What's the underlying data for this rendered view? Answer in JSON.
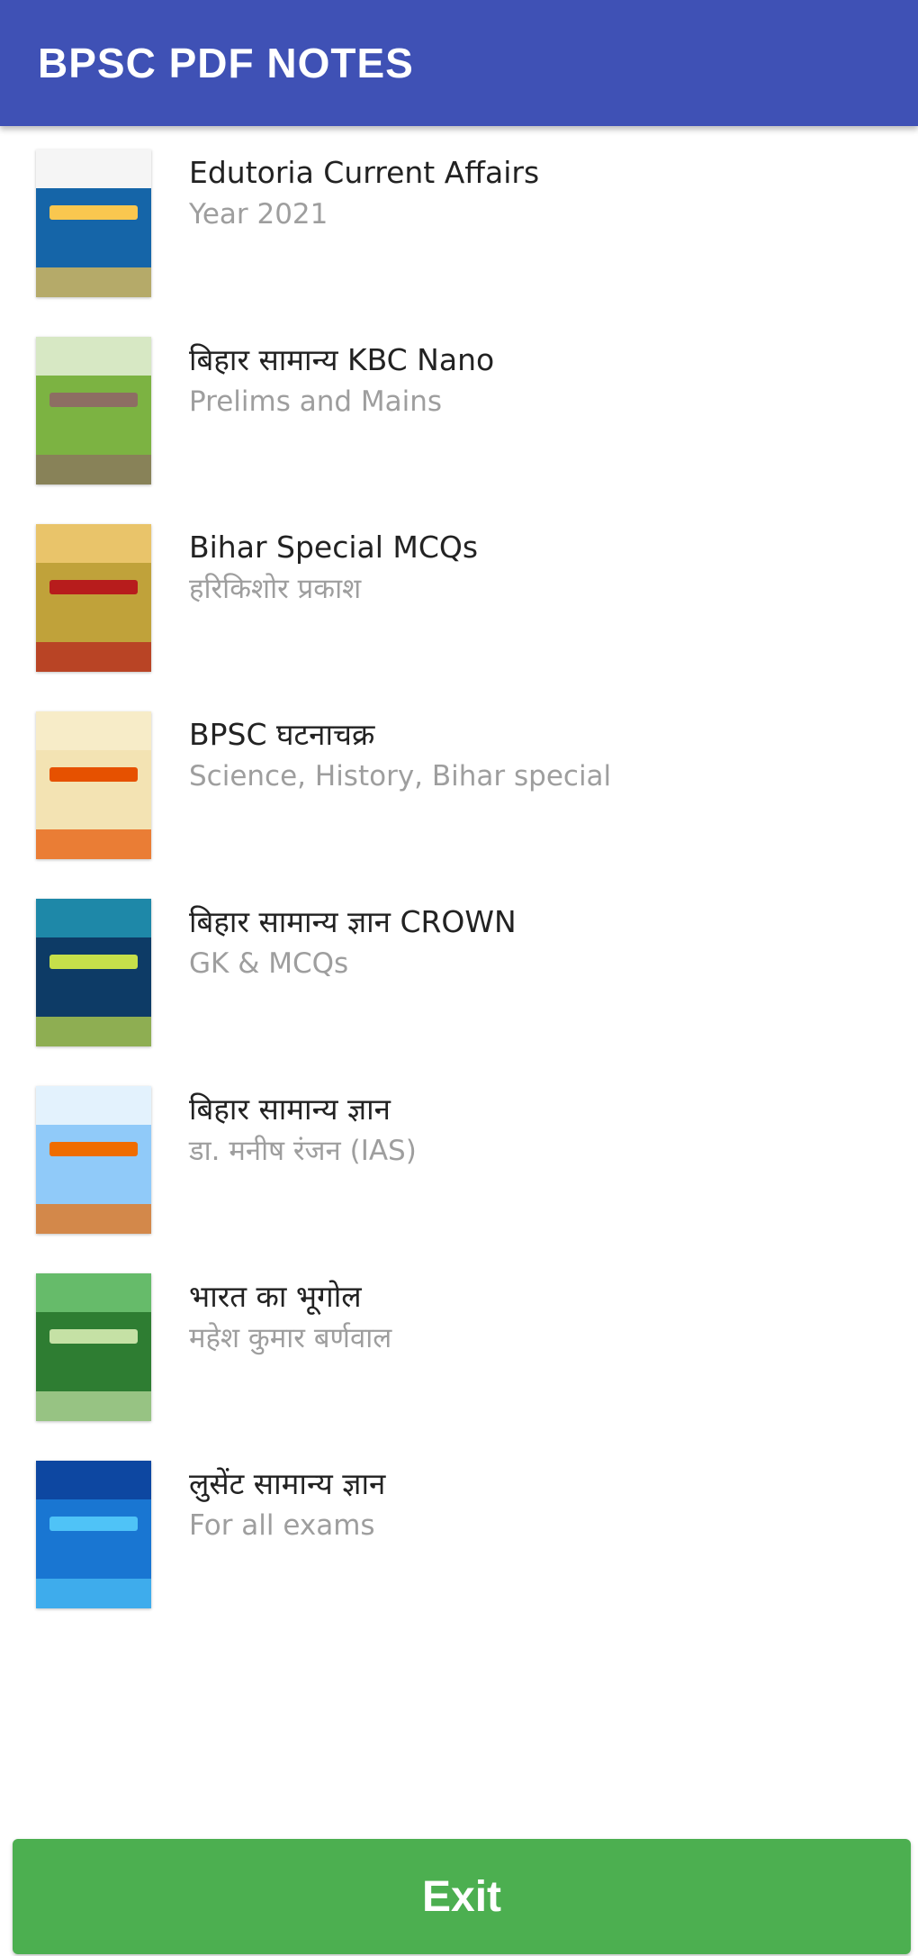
{
  "app_bar": {
    "title": "BPSC PDF NOTES"
  },
  "books": [
    {
      "title": "Edutoria Current Affairs",
      "subtitle": "Year 2021",
      "cover": {
        "bg": "#1565a8",
        "top": "#f5f5f5",
        "accent": "#f9c74f"
      }
    },
    {
      "title": "बिहार सामान्य KBC Nano",
      "subtitle": "Prelims and Mains",
      "cover": {
        "bg": "#7cb342",
        "top": "#d7e8c4",
        "accent": "#8d6e63"
      }
    },
    {
      "title": "Bihar Special MCQs",
      "subtitle": "हरिकिशोर प्रकाश",
      "cover": {
        "bg": "#c0a23a",
        "top": "#e9c46a",
        "accent": "#b71c1c"
      }
    },
    {
      "title": "BPSC घटनाचक्र",
      "subtitle": "Science, History, Bihar special",
      "cover": {
        "bg": "#f3e3b3",
        "top": "#f7ecc8",
        "accent": "#e65100"
      }
    },
    {
      "title": "बिहार सामान्य ज्ञान CROWN",
      "subtitle": " GK & MCQs",
      "cover": {
        "bg": "#0d3b66",
        "top": "#1e88a8",
        "accent": "#c6e04a"
      }
    },
    {
      "title": "बिहार सामान्य ज्ञान",
      "subtitle": "डा. मनीष रंजन (IAS)",
      "cover": {
        "bg": "#90caf9",
        "top": "#e3f2fd",
        "accent": "#ef6c00"
      }
    },
    {
      "title": "भारत का भूगोल",
      "subtitle": "महेश कुमार बर्णवाल",
      "cover": {
        "bg": "#2e7d32",
        "top": "#66bb6a",
        "accent": "#c5e1a5"
      }
    },
    {
      "title": "लुसेंट सामान्य ज्ञान",
      "subtitle": "For all exams",
      "cover": {
        "bg": "#1976d2",
        "top": "#0d47a1",
        "accent": "#4fc3f7"
      }
    }
  ],
  "footer": {
    "exit_label": "Exit"
  }
}
